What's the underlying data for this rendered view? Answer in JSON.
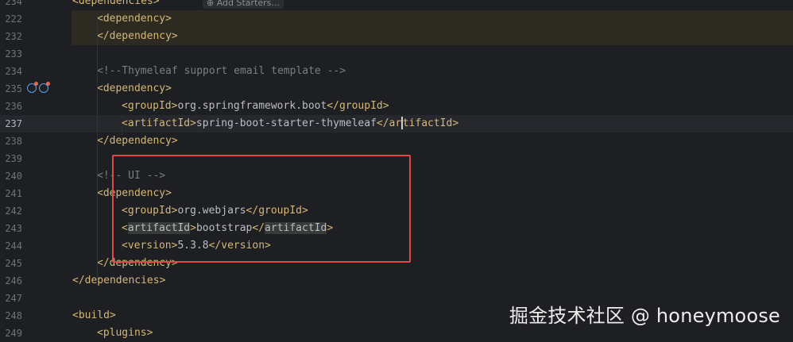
{
  "editor": {
    "inlay_hint": "Add Starters...",
    "lines": [
      {
        "num": "234",
        "parts": [
          {
            "c": "tag",
            "t": "<dependencies>"
          }
        ],
        "indent": 1,
        "partial": true
      },
      {
        "num": "222",
        "parts": [
          {
            "c": "tag",
            "t": "<dependency>"
          }
        ],
        "indent": 2
      },
      {
        "num": "232",
        "parts": [
          {
            "c": "tag",
            "t": "</dependency>"
          }
        ],
        "indent": 2
      },
      {
        "num": "233",
        "parts": [],
        "indent": 0
      },
      {
        "num": "234",
        "parts": [
          {
            "c": "cmt",
            "t": "<!--Thymeleaf support email template -->"
          }
        ],
        "indent": 2
      },
      {
        "num": "235",
        "parts": [
          {
            "c": "tag",
            "t": "<dependency>"
          }
        ],
        "indent": 2
      },
      {
        "num": "236",
        "parts": [
          {
            "c": "tag",
            "t": "<groupId>"
          },
          {
            "c": "txt",
            "t": "org.springframework.boot"
          },
          {
            "c": "tag",
            "t": "</groupId>"
          }
        ],
        "indent": 3
      },
      {
        "num": "237",
        "parts": [
          {
            "c": "tag",
            "t": "<artifactId>"
          },
          {
            "c": "txt",
            "t": "spring-boot-starter-thymeleaf"
          },
          {
            "c": "tag",
            "t": "</ar"
          },
          {
            "c": "caret",
            "t": ""
          },
          {
            "c": "tag",
            "t": "tifactId>"
          }
        ],
        "indent": 3
      },
      {
        "num": "238",
        "parts": [
          {
            "c": "tag",
            "t": "</dependency>"
          }
        ],
        "indent": 2
      },
      {
        "num": "239",
        "parts": [],
        "indent": 0
      },
      {
        "num": "240",
        "parts": [
          {
            "c": "cmt",
            "t": "<!-- UI -->"
          }
        ],
        "indent": 2
      },
      {
        "num": "241",
        "parts": [
          {
            "c": "tag",
            "t": "<dependency>"
          }
        ],
        "indent": 2
      },
      {
        "num": "242",
        "parts": [
          {
            "c": "tag",
            "t": "<groupId>"
          },
          {
            "c": "txt",
            "t": "org.webjars"
          },
          {
            "c": "tag",
            "t": "</groupId>"
          }
        ],
        "indent": 3
      },
      {
        "num": "243",
        "parts": [
          {
            "c": "tag",
            "t": "<"
          },
          {
            "c": "tagbox",
            "t": "artifactId"
          },
          {
            "c": "tag",
            "t": ">"
          },
          {
            "c": "txt",
            "t": "bootstrap"
          },
          {
            "c": "tag",
            "t": "</"
          },
          {
            "c": "tagbox",
            "t": "artifactId"
          },
          {
            "c": "tag",
            "t": ">"
          }
        ],
        "indent": 3
      },
      {
        "num": "244",
        "parts": [
          {
            "c": "tag",
            "t": "<version>"
          },
          {
            "c": "txt",
            "t": "5.3.8"
          },
          {
            "c": "tag",
            "t": "</version>"
          }
        ],
        "indent": 3
      },
      {
        "num": "245",
        "parts": [
          {
            "c": "tag",
            "t": "</dependency>"
          }
        ],
        "indent": 2
      },
      {
        "num": "246",
        "parts": [
          {
            "c": "tag",
            "t": "</dependencies>"
          }
        ],
        "indent": 1
      },
      {
        "num": "247",
        "parts": [],
        "indent": 0
      },
      {
        "num": "248",
        "parts": [
          {
            "c": "tag",
            "t": "<build>"
          }
        ],
        "indent": 1
      },
      {
        "num": "249",
        "parts": [
          {
            "c": "tag",
            "t": "<plugins>"
          }
        ],
        "indent": 2
      }
    ]
  },
  "watermark": "掘金技术社区 @ honeymoose",
  "colors": {
    "background": "#1e1f22",
    "tag": "#d5b778",
    "comment": "#7a7e85",
    "text": "#bcbec4",
    "highlight_box": "#e04848"
  }
}
